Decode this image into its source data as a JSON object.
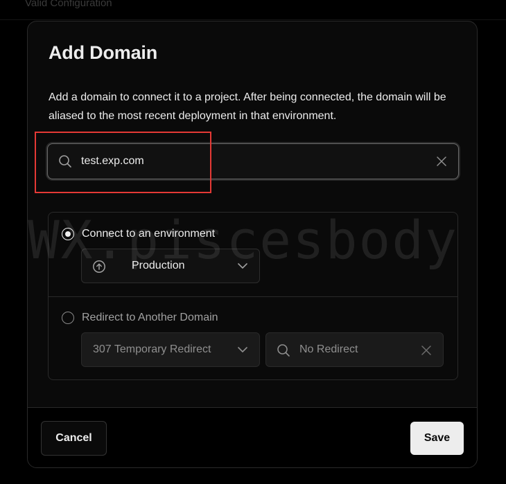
{
  "background": {
    "text": "Valid Configuration"
  },
  "modal": {
    "title": "Add Domain",
    "description": "Add a domain to connect it to a project. After being connected, the domain will be aliased to the most recent deployment in that environment.",
    "domain_input": {
      "value": "test.exp.com",
      "icon": "search-icon",
      "clear_icon": "close-icon"
    },
    "options": {
      "connect": {
        "label": "Connect to an environment",
        "checked": true,
        "environment": {
          "value": "Production",
          "icon": "arrow-up-circle-icon"
        }
      },
      "redirect": {
        "label": "Redirect to Another Domain",
        "checked": false,
        "type": "307 Temporary Redirect",
        "target_placeholder": "No Redirect"
      }
    },
    "footer": {
      "cancel_label": "Cancel",
      "save_label": "Save"
    }
  },
  "watermark": "WX:piscesbody",
  "colors": {
    "background": "#000000",
    "modal_bg": "#0a0a0a",
    "text_primary": "#ededed",
    "text_muted": "#8f8f8f",
    "save_button_bg": "#ededed",
    "highlight": "#e53935"
  }
}
